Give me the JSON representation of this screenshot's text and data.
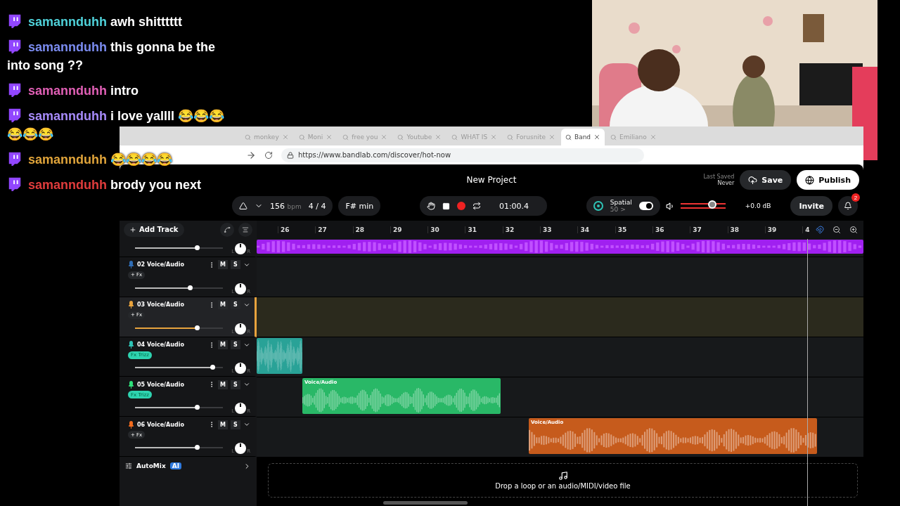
{
  "chat": [
    {
      "user": "samannduhh",
      "color": "#4fd1d9",
      "message": "awh shitttttt"
    },
    {
      "user": "samannduhh",
      "color": "#7b8cf0",
      "message": "this gonna be the into song ??"
    },
    {
      "user": "samannduhh",
      "color": "#e05fb5",
      "message": "intro"
    },
    {
      "user": "samannduhh",
      "color": "#a78bfa",
      "message": "i love yallll 😂😂😂😂😂😂"
    },
    {
      "user": "samannduhh",
      "color": "#e0a43a",
      "message": "😂😂😂😂"
    },
    {
      "user": "samannduhh",
      "color": "#e03c3c",
      "message": "brody you next"
    }
  ],
  "browser": {
    "tabs": [
      {
        "label": "monkey",
        "selected": false
      },
      {
        "label": "Moni",
        "selected": false
      },
      {
        "label": "free you",
        "selected": false
      },
      {
        "label": "Youtube",
        "selected": false
      },
      {
        "label": "WHAT IS",
        "selected": false
      },
      {
        "label": "Forusnite",
        "selected": false
      },
      {
        "label": "Band",
        "selected": true
      },
      {
        "label": "Emiliano",
        "selected": false
      }
    ],
    "address": "https://www.bandlab.com/discover/hot-now"
  },
  "app": {
    "title": "New Project",
    "last_saved_label": "Last Saved",
    "last_saved_value": "Never",
    "save": "Save",
    "publish": "Publish",
    "invite": "Invite",
    "notifications": "2",
    "bpm": "156",
    "bpm_unit": "bpm",
    "time_signature": [
      "4",
      "/",
      "4"
    ],
    "key": "F# min",
    "time": "01:00.4",
    "spatial": {
      "label": "Spatial",
      "value": "50 >",
      "on": true
    },
    "master": {
      "level": 0.7,
      "gain": "+0.0 dB"
    },
    "add_track": "Add Track",
    "ruler": [
      "26",
      "27",
      "28",
      "29",
      "30",
      "31",
      "32",
      "33",
      "34",
      "35",
      "36",
      "37",
      "38",
      "39",
      "4"
    ],
    "tracks": [
      {
        "kind": "cut",
        "color": "#a020f0",
        "level": 0.7,
        "pan_left": "L",
        "pan_right": "R",
        "selected": false
      },
      {
        "kind": "full",
        "number": "02",
        "name": "Voice/Audio",
        "color": "#2f6db5",
        "fx": {
          "kind": "add",
          "label": "+ Fx"
        },
        "mute": "M",
        "solo": "S",
        "level": 0.62,
        "pan_left": "L",
        "pan_right": "R",
        "selected": false
      },
      {
        "kind": "full",
        "number": "03",
        "name": "Voice/Audio",
        "color": "#e8a33d",
        "fx": {
          "kind": "add",
          "label": "+ Fx"
        },
        "mute": "M",
        "solo": "S",
        "level": 0.7,
        "pan_left": "L",
        "pan_right": "R",
        "selected": true
      },
      {
        "kind": "full",
        "number": "04",
        "name": "Voice/Audio",
        "color": "#2ec4b6",
        "fx": {
          "kind": "preset",
          "label": "Fx Trizz"
        },
        "mute": "M",
        "solo": "S",
        "level": 0.88,
        "pan_left": "L",
        "pan_right": "R",
        "selected": false
      },
      {
        "kind": "full",
        "number": "05",
        "name": "Voice/Audio",
        "color": "#2ee07a",
        "fx": {
          "kind": "preset",
          "label": "Fx Trizz"
        },
        "mute": "M",
        "solo": "S",
        "level": 0.7,
        "clip_label": "Voice/Audio",
        "pan_left": "L",
        "pan_right": "R",
        "selected": false
      },
      {
        "kind": "full",
        "number": "06",
        "name": "Voice/Audio",
        "color": "#f26b1d",
        "fx": {
          "kind": "add",
          "label": "+ Fx"
        },
        "mute": "M",
        "solo": "S",
        "level": 0.7,
        "clip_label": "Voice/Audio",
        "pan_left": "L",
        "pan_right": "R",
        "selected": false
      }
    ],
    "automix": {
      "label": "AutoMix",
      "badge": "AI"
    },
    "drop_text": "Drop a loop or an audio/MIDI/video file"
  }
}
